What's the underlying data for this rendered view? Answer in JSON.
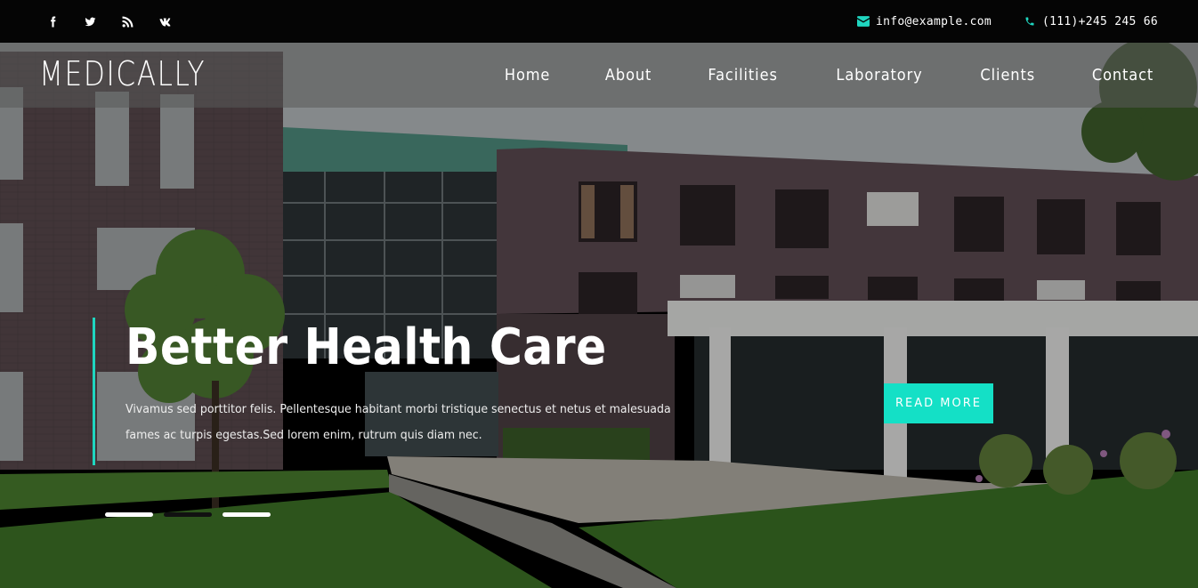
{
  "topbar": {
    "social": [
      {
        "name": "facebook-icon"
      },
      {
        "name": "twitter-icon"
      },
      {
        "name": "rss-icon"
      },
      {
        "name": "vk-icon"
      }
    ],
    "email": "info@example.com",
    "phone": "(111)+245 245 66"
  },
  "nav": {
    "logo": "MEDICALLY",
    "items": [
      "Home",
      "About",
      "Facilities",
      "Laboratory",
      "Clients",
      "Contact"
    ]
  },
  "hero": {
    "title": "Better Health Care",
    "text": "Vivamus sed porttitor felis. Pellentesque habitant morbi tristique senectus et netus et malesuada fames ac turpis egestas.Sed lorem enim, rutrum quis diam nec.",
    "button": "READ MORE",
    "slides": 3,
    "active_slide": 2
  },
  "colors": {
    "accent": "#1fd6c0",
    "button": "#14e0c6",
    "topbar": "#050505"
  }
}
